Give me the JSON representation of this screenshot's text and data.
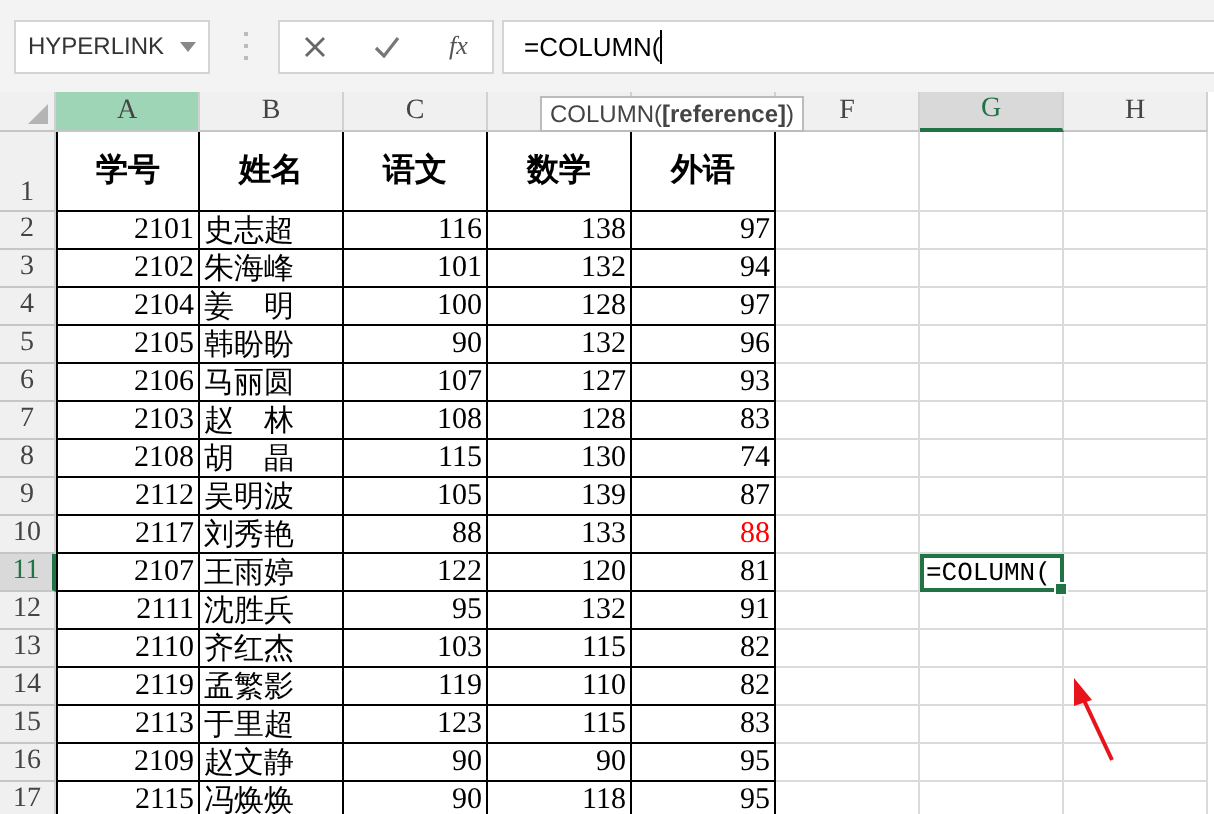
{
  "formula_bar": {
    "name_box": "HYPERLINK",
    "fx": "fx",
    "formula": "=COLUMN("
  },
  "tooltip": "COLUMN(**[reference]**)",
  "columns": [
    {
      "label": "A",
      "referenced": true,
      "selected": false
    },
    {
      "label": "B",
      "referenced": false,
      "selected": false
    },
    {
      "label": "C",
      "referenced": false,
      "selected": false
    },
    {
      "referenced": false,
      "selected": false
    },
    {
      "referenced": false,
      "selected": false
    },
    {
      "label": "F",
      "referenced": false,
      "selected": false
    },
    {
      "label": "G",
      "referenced": false,
      "selected": true
    },
    {
      "label": "H",
      "referenced": false,
      "selected": false
    }
  ],
  "header_row": {
    "number": "1",
    "cells": [
      "学号",
      "姓名",
      "语文",
      "数学",
      "外语"
    ]
  },
  "rows": [
    {
      "number": "2",
      "selected": false,
      "cells": [
        "2101",
        "史志超",
        "116",
        "138",
        "97"
      ]
    },
    {
      "number": "3",
      "selected": false,
      "cells": [
        "2102",
        "朱海峰",
        "101",
        "132",
        "94"
      ]
    },
    {
      "number": "4",
      "selected": false,
      "cells": [
        "2104",
        "姜　明",
        "100",
        "128",
        "97"
      ]
    },
    {
      "number": "5",
      "selected": false,
      "cells": [
        "2105",
        "韩盼盼",
        "90",
        "132",
        "96"
      ]
    },
    {
      "number": "6",
      "selected": false,
      "cells": [
        "2106",
        "马丽圆",
        "107",
        "127",
        "93"
      ]
    },
    {
      "number": "7",
      "selected": false,
      "cells": [
        "2103",
        "赵　林",
        "108",
        "128",
        "83"
      ]
    },
    {
      "number": "8",
      "selected": false,
      "cells": [
        "2108",
        "胡　晶",
        "115",
        "130",
        "74"
      ]
    },
    {
      "number": "9",
      "selected": false,
      "cells": [
        "2112",
        "吴明波",
        "105",
        "139",
        "87"
      ]
    },
    {
      "number": "10",
      "selected": false,
      "cells": [
        "2117",
        "刘秀艳",
        "88",
        "133",
        "88"
      ],
      "english_flagged": true
    },
    {
      "number": "11",
      "selected": true,
      "cells": [
        "2107",
        "王雨婷",
        "122",
        "120",
        "81"
      ]
    },
    {
      "number": "12",
      "selected": false,
      "cells": [
        "2111",
        "沈胜兵",
        "95",
        "132",
        "91"
      ]
    },
    {
      "number": "13",
      "selected": false,
      "cells": [
        "2110",
        "齐红杰",
        "103",
        "115",
        "82"
      ]
    },
    {
      "number": "14",
      "selected": false,
      "cells": [
        "2119",
        "孟繁影",
        "119",
        "110",
        "82"
      ]
    },
    {
      "number": "15",
      "selected": false,
      "cells": [
        "2113",
        "于里超",
        "123",
        "115",
        "83"
      ]
    },
    {
      "number": "16",
      "selected": false,
      "cells": [
        "2109",
        "赵文静",
        "90",
        "90",
        "95"
      ]
    },
    {
      "number": "17",
      "selected": false,
      "cells": [
        "2115",
        "冯焕焕",
        "90",
        "118",
        "95"
      ]
    }
  ],
  "active_cell": {
    "text": "=COLUMN("
  }
}
